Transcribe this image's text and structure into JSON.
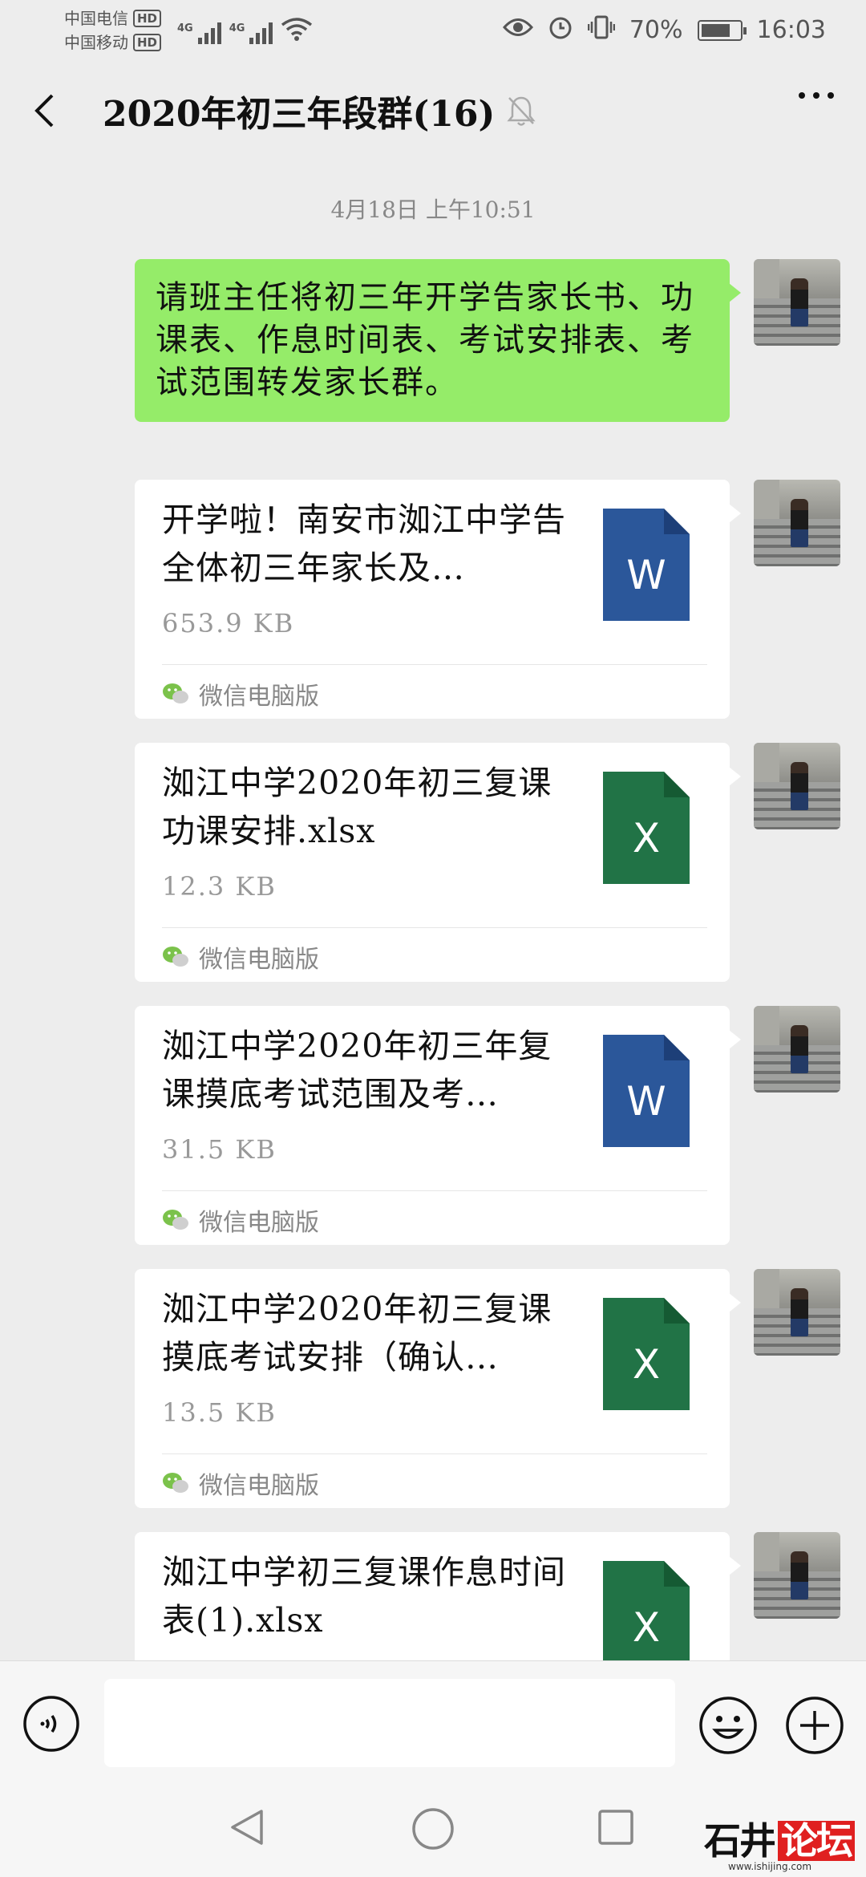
{
  "status_bar": {
    "carrier1": "中国电信",
    "carrier2": "中国移动",
    "hd": "HD",
    "net": "4G",
    "battery": "70%",
    "battery_level": 0.7,
    "time": "16:03"
  },
  "header": {
    "title": "2020年初三年段群(16)"
  },
  "timestamp": "4月18日 上午10:51",
  "messages": [
    {
      "type": "text",
      "text": "请班主任将初三年开学告家长书、功课表、作息时间表、考试安排表、考试范围转发家长群。"
    },
    {
      "type": "file",
      "file_type": "W",
      "name": "开学啦！南安市洳江中学告全体初三年家长及…",
      "size": "653.9 KB",
      "source": "微信电脑版"
    },
    {
      "type": "file",
      "file_type": "X",
      "name": "洳江中学2020年初三复课功课安排.xlsx",
      "size": "12.3 KB",
      "source": "微信电脑版"
    },
    {
      "type": "file",
      "file_type": "W",
      "name": "洳江中学2020年初三年复课摸底考试范围及考…",
      "size": "31.5 KB",
      "source": "微信电脑版"
    },
    {
      "type": "file",
      "file_type": "X",
      "name": "洳江中学2020年初三复课摸底考试安排（确认…",
      "size": "13.5 KB",
      "source": "微信电脑版"
    },
    {
      "type": "file",
      "file_type": "X",
      "name": "洳江中学初三复课作息时间表(1).xlsx",
      "size": "",
      "source": ""
    }
  ],
  "input": {
    "value": "",
    "placeholder": ""
  },
  "watermark": {
    "brand_a": "石井",
    "brand_b": "论坛",
    "url": "www.ishijing.com"
  },
  "colors": {
    "sent_bubble": "#95ec69",
    "word_icon": "#2b579a",
    "excel_icon": "#217346",
    "background": "#ededed"
  }
}
